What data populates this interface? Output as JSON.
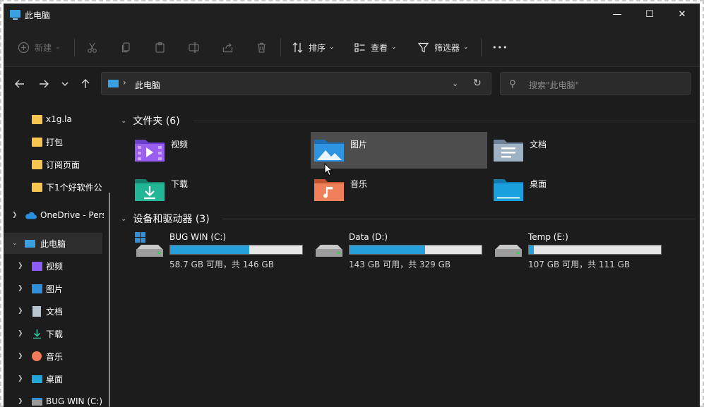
{
  "window": {
    "title": "此电脑",
    "controls": {
      "minimize": "—",
      "maximize": "☐",
      "close": "✕"
    }
  },
  "toolbar": {
    "new_label": "新建",
    "sort_label": "排序",
    "view_label": "查看",
    "filter_label": "筛选器",
    "more_label": "•••"
  },
  "address": {
    "path": "此电脑",
    "separator": "›",
    "search_placeholder": "搜索\"此电脑\""
  },
  "nav": {
    "quick_items": [
      {
        "label": "x1g.la"
      },
      {
        "label": "打包"
      },
      {
        "label": "订阅页面"
      },
      {
        "label": "下1个好软件公"
      }
    ],
    "onedrive": {
      "label": "OneDrive - Pers"
    },
    "thispc": {
      "label": "此电脑"
    },
    "pc_children": [
      {
        "label": "视频"
      },
      {
        "label": "图片"
      },
      {
        "label": "文档"
      },
      {
        "label": "下载"
      },
      {
        "label": "音乐"
      },
      {
        "label": "桌面"
      },
      {
        "label": "BUG WIN (C:)"
      }
    ]
  },
  "content": {
    "folders_header": "文件夹 (6)",
    "folders": [
      {
        "label": "视频"
      },
      {
        "label": "图片"
      },
      {
        "label": "文档"
      },
      {
        "label": "下载"
      },
      {
        "label": "音乐"
      },
      {
        "label": "桌面"
      }
    ],
    "drives_header": "设备和驱动器 (3)",
    "drives": [
      {
        "name": "BUG WIN (C:)",
        "info": "58.7 GB 可用，共 146 GB",
        "used_fraction": 0.6
      },
      {
        "name": "Data (D:)",
        "info": "143 GB 可用，共 329 GB",
        "used_fraction": 0.57
      },
      {
        "name": "Temp (E:)",
        "info": "107 GB 可用，共 111 GB",
        "used_fraction": 0.04
      }
    ]
  },
  "colors": {
    "accent": "#26a0da",
    "background": "#1c1c1c",
    "hover": "#4d4d4d",
    "quick_folder": "#f5c451"
  }
}
